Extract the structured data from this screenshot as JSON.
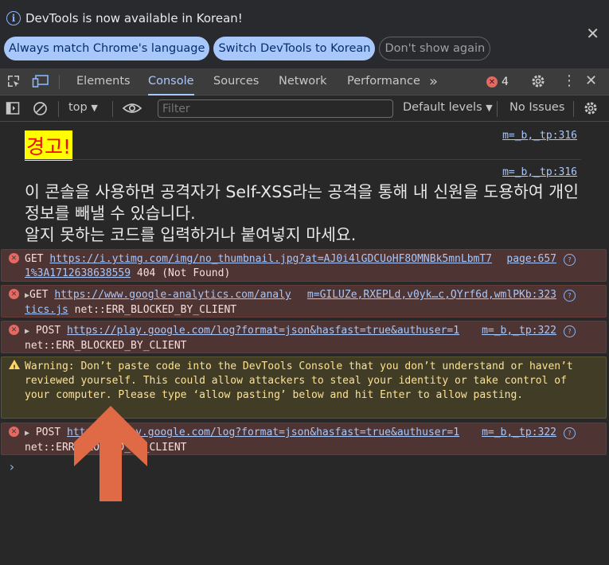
{
  "infobar": {
    "message": "DevTools is now available in Korean!",
    "buttons": [
      "Always match Chrome's language",
      "Switch DevTools to Korean",
      "Don't show again"
    ]
  },
  "tabs": {
    "items": [
      "Elements",
      "Console",
      "Sources",
      "Network",
      "Performance"
    ],
    "active": "Console",
    "more": "»",
    "error_count": "4"
  },
  "toolbar": {
    "context": "top",
    "filter_placeholder": "Filter",
    "levels": "Default levels",
    "issues": "No Issues"
  },
  "messages": {
    "warning_title": "경고!",
    "warning_title_source": "m=_b,_tp:316",
    "warning_body": "이 콘솔을 사용하면 공격자가 Self-XSS라는 공격을 통해 내 신원을 도용하여 개인 정보를 빼낼 수 있습니다.\n알지 못하는 코드를 입력하거나 붙여넣지 마세요.",
    "warning_body_source": "m=_b,_tp:316",
    "rows": [
      {
        "method": "GET ",
        "url": "https://i.ytimg.com/img/no_thumbnail.jpg?at=AJ0i4lGDCUoHF8OMNBk5mnLbmT71%3A1712638638559",
        "status": " 404 (Not Found)",
        "source": "page:657"
      },
      {
        "method": "GET ",
        "url": "https://www.google-analytics.com/analytics.js",
        "status": " net::ERR_BLOCKED_BY_CLIENT",
        "source": "m=GILUZe,RXEPLd,v0yk…c,QYrf6d,wmlPKb:323"
      },
      {
        "method": "POST ",
        "url": "https://play.google.com/log?format=json&hasfast=true&authuser=1",
        "status": "net::ERR_BLOCKED_BY_CLIENT",
        "source": "m=_b,_tp:322"
      },
      {
        "text": "Warning: Don’t paste code into the DevTools Console that you don’t understand or haven’t reviewed yourself. This could allow attackers to steal your identity or take control of your computer. Please type ‘allow pasting’ below and hit Enter to allow pasting."
      },
      {
        "method": "POST ",
        "url": "https://play.google.com/log?format=json&hasfast=true&authuser=1",
        "status": "net::ERR_BLOCKED_BY_CLIENT",
        "source": "m=_b,_tp:322"
      }
    ]
  },
  "colors": {
    "accent": "#a8c7fa",
    "error_bg": "#4e3534",
    "warning_bg": "#413c26",
    "annotation_arrow": "#e06a45"
  }
}
